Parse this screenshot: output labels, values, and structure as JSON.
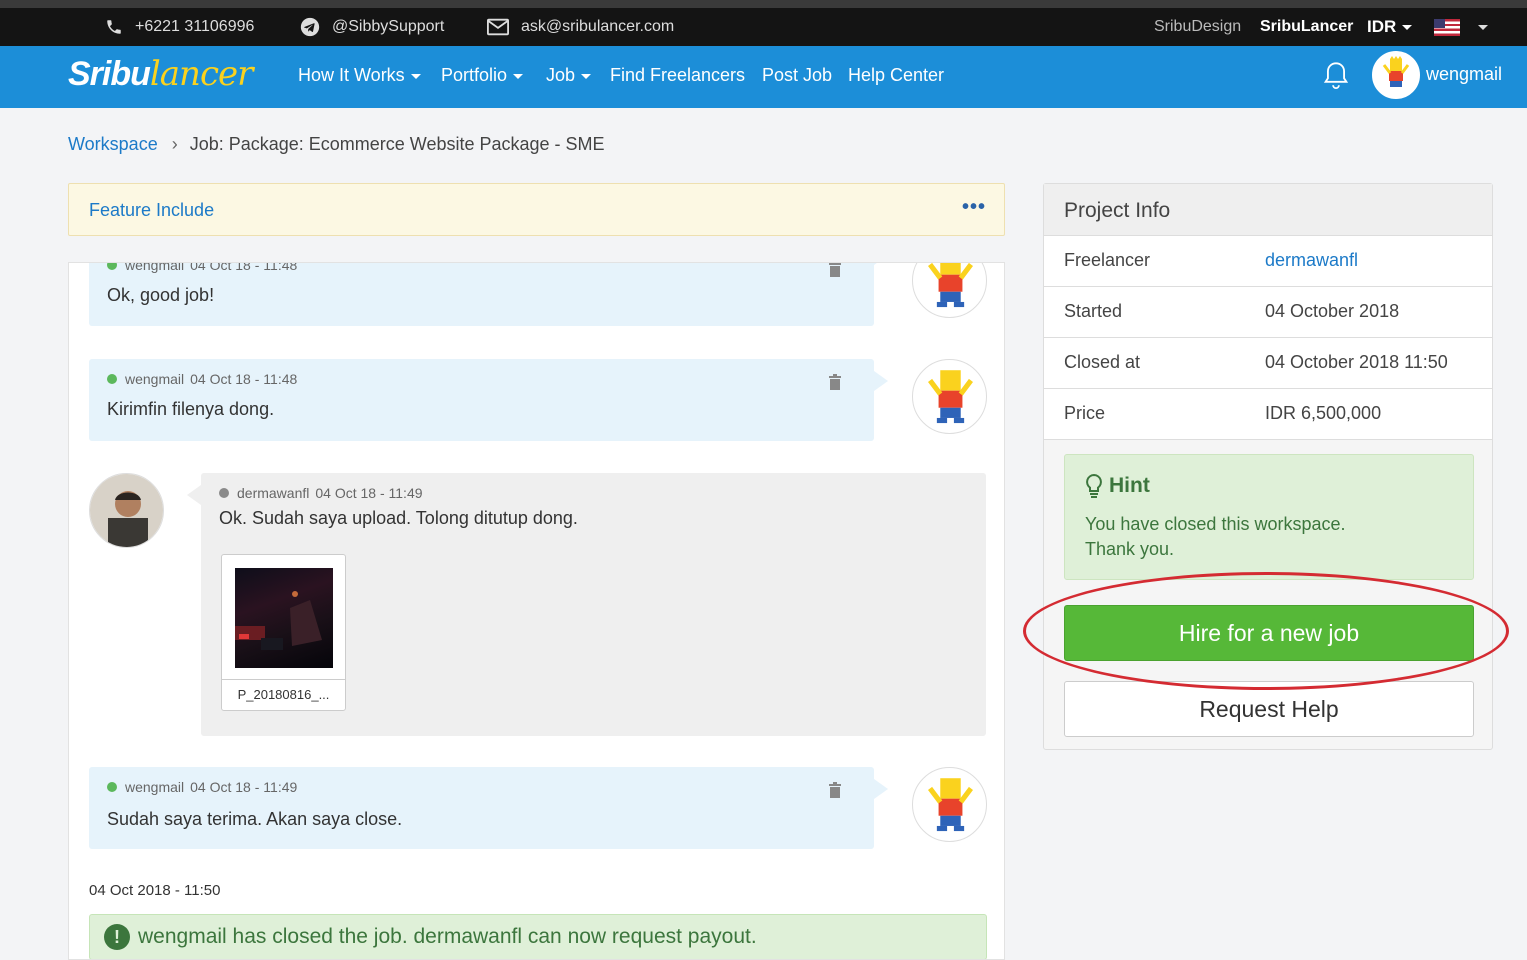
{
  "topbar": {
    "phone": "+6221 31106996",
    "telegram": "@SibbySupport",
    "email": "ask@sribulancer.com",
    "sites": [
      "SribuDesign",
      "SribuLancer"
    ],
    "currency": "IDR"
  },
  "nav": {
    "logo_a": "Sribu",
    "logo_b": "lancer",
    "links": [
      "How It Works",
      "Portfolio",
      "Job",
      "Find Freelancers",
      "Post Job",
      "Help Center"
    ],
    "username": "wengmail"
  },
  "breadcrumb": {
    "root": "Workspace",
    "current": "Job: Package: Ecommerce Website Package - SME"
  },
  "feature": {
    "title": "Feature Include",
    "menu": "•••"
  },
  "messages": [
    {
      "user": "wengmail",
      "time": "04 Oct 18 - 11:48",
      "text": "Ok, good job!"
    },
    {
      "user": "wengmail",
      "time": "04 Oct 18 - 11:48",
      "text": "Kirimfin filenya dong."
    },
    {
      "user": "dermawanfl",
      "time": "04 Oct 18 - 11:49",
      "text": "Ok. Sudah saya upload. Tolong ditutup dong.",
      "attachment": "P_20180816_..."
    },
    {
      "user": "wengmail",
      "time": "04 Oct 18 - 11:49",
      "text": "Sudah saya terima. Akan saya close."
    }
  ],
  "closed": {
    "date": "04 Oct 2018 - 11:50",
    "message": "wengmail has closed the job. dermawanfl can now request payout."
  },
  "project_info": {
    "title": "Project Info",
    "rows": [
      {
        "label": "Freelancer",
        "value": "dermawanfl"
      },
      {
        "label": "Started",
        "value": "04 October 2018"
      },
      {
        "label": "Closed at",
        "value": "04 October 2018 11:50"
      },
      {
        "label": "Price",
        "value": "IDR 6,500,000"
      }
    ],
    "hint_title": "Hint",
    "hint_line1": "You have closed this workspace.",
    "hint_line2": "Thank you.",
    "hire_button": "Hire for a new job",
    "help_button": "Request Help"
  },
  "colors": {
    "nav": "#1c8ed8",
    "accent_green": "#56b838",
    "link": "#1c7ac8",
    "annotation": "#d42b32"
  }
}
